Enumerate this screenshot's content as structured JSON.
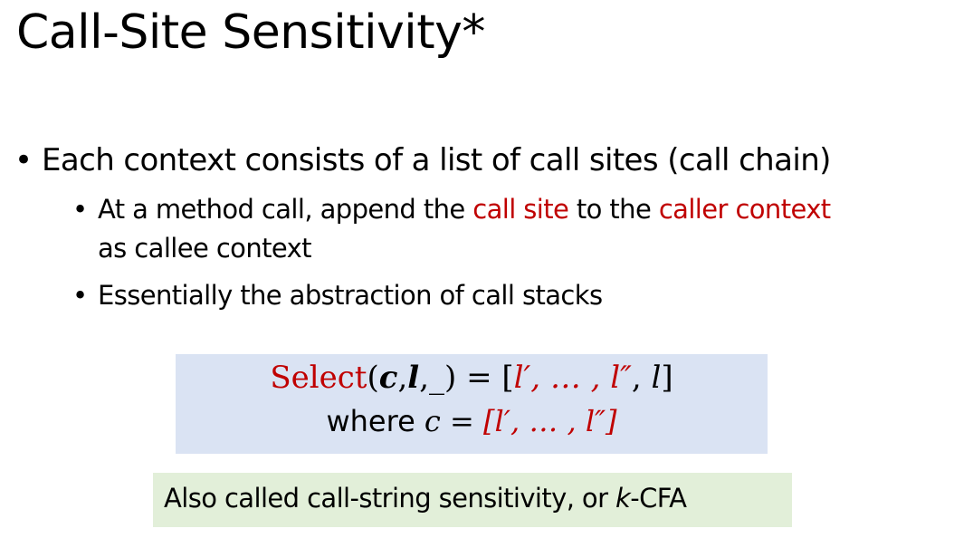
{
  "slide": {
    "title": "Call-Site Sensitivity*",
    "bullets": [
      {
        "marker": "•",
        "text": "Each context consists of a list of call sites (call chain)"
      }
    ],
    "sub_bullets": [
      {
        "marker": "•",
        "parts": [
          "At a method call, append the ",
          "call site",
          " to the ",
          "caller context"
        ],
        "continuation": "as callee context"
      },
      {
        "marker": "•",
        "text": "Essentially the abstraction of call stacks"
      }
    ],
    "formula": {
      "line1": {
        "select": "Select",
        "open_paren": "(",
        "c": "c",
        "comma1": ",",
        "l": "l",
        "comma2": ",",
        "underscore": "_",
        "close_paren": ")",
        "eq": " = ",
        "list_open": "[",
        "list_items": "l′, … , l″",
        "list_tail_comma": ", ",
        "list_last": "l",
        "list_close": "]"
      },
      "line2": {
        "where": "where ",
        "c": "c",
        "eq": " = ",
        "list": "[l′, … , l″]"
      }
    },
    "note": {
      "prefix": "Also called call-string sensitivity, or ",
      "k": "k",
      "suffix": "-CFA"
    },
    "colors": {
      "accent_red": "#c00000",
      "formula_bg": "#dae3f3",
      "note_bg": "#e2efd9"
    }
  }
}
